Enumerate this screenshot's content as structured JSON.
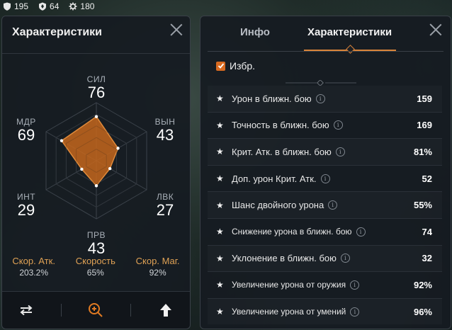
{
  "resources": [
    {
      "icon": "shield-icon",
      "value": "195"
    },
    {
      "icon": "badge-icon",
      "value": "64"
    },
    {
      "icon": "gear-icon",
      "value": "180"
    }
  ],
  "left_panel": {
    "title": "Характеристики",
    "stats": [
      {
        "label": "СИЛ",
        "value": "76"
      },
      {
        "label": "ВЫН",
        "value": "43"
      },
      {
        "label": "ЛВК",
        "value": "27"
      },
      {
        "label": "ПРВ",
        "value": "43"
      },
      {
        "label": "ИНТ",
        "value": "29"
      },
      {
        "label": "МДР",
        "value": "69"
      }
    ],
    "radar_fill_color": "#c4661c",
    "radar_levels": [
      0.76,
      0.43,
      0.27,
      0.43,
      0.29,
      0.69
    ],
    "speeds": [
      {
        "label": "Скор. Атк.",
        "value": "203.2%"
      },
      {
        "label": "Скорость",
        "value": "65%"
      },
      {
        "label": "Скор. Маг.",
        "value": "92%"
      }
    ],
    "buttons": [
      {
        "icon": "swap-arrows-icon"
      },
      {
        "icon": "zoom-in-icon"
      },
      {
        "icon": "arrow-up-icon"
      }
    ]
  },
  "right_panel": {
    "tabs": {
      "info": "Инфо",
      "chars": "Характеристики"
    },
    "active_tab": "chars",
    "favorite_label": "Избр.",
    "rows": [
      {
        "name": "Урон в ближн. бою",
        "value": "159"
      },
      {
        "name": "Точность в ближн. бою",
        "value": "169"
      },
      {
        "name": "Крит. Атк. в ближн. бою",
        "value": "81%"
      },
      {
        "name": "Доп. урон Крит. Атк.",
        "value": "52"
      },
      {
        "name": "Шанс двойного урона",
        "value": "55%"
      },
      {
        "name": "Снижение урона в ближн. бою",
        "value": "74"
      },
      {
        "name": "Уклонение в ближн. бою",
        "value": "32"
      },
      {
        "name": "Увеличение урона от оружия",
        "value": "92%"
      },
      {
        "name": "Увеличение урона от умений",
        "value": "96%"
      }
    ]
  },
  "colors": {
    "accent": "#d9843a",
    "speed_label": "#e0a255"
  }
}
